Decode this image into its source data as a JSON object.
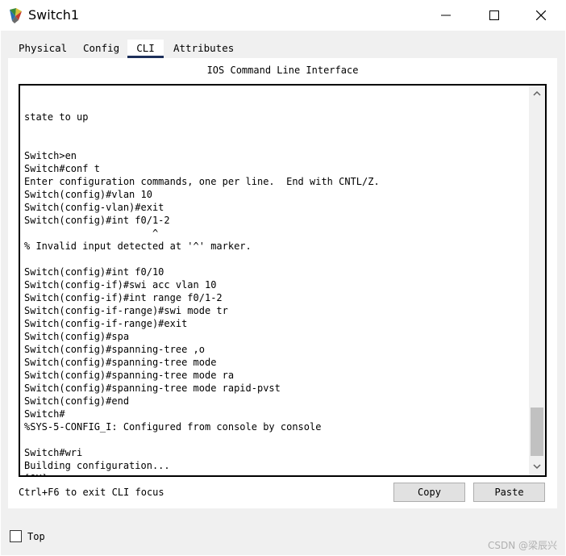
{
  "window": {
    "title": "Switch1",
    "minimize_icon": "minimize-icon",
    "maximize_icon": "maximize-icon",
    "close_icon": "close-icon"
  },
  "tabs": [
    {
      "label": "Physical"
    },
    {
      "label": "Config"
    },
    {
      "label": "CLI",
      "active": true
    },
    {
      "label": "Attributes"
    }
  ],
  "panel": {
    "header": "IOS Command Line Interface"
  },
  "console": {
    "lines": [
      "state to up",
      "",
      "",
      "Switch>en",
      "Switch#conf t",
      "Enter configuration commands, one per line.  End with CNTL/Z.",
      "Switch(config)#vlan 10",
      "Switch(config-vlan)#exit",
      "Switch(config)#int f0/1-2",
      "                      ^",
      "% Invalid input detected at '^' marker.",
      "",
      "Switch(config)#int f0/10",
      "Switch(config-if)#swi acc vlan 10",
      "Switch(config-if)#int range f0/1-2",
      "Switch(config-if-range)#swi mode tr",
      "Switch(config-if-range)#exit",
      "Switch(config)#spa",
      "Switch(config)#spanning-tree ,o",
      "Switch(config)#spanning-tree mode",
      "Switch(config)#spanning-tree mode ra",
      "Switch(config)#spanning-tree mode rapid-pvst",
      "Switch(config)#end",
      "Switch#",
      "%SYS-5-CONFIG_I: Configured from console by console",
      "",
      "Switch#wri",
      "Building configuration...",
      "[OK]"
    ],
    "prompt": "Switch#"
  },
  "footer": {
    "hint": "Ctrl+F6 to exit CLI focus",
    "copy_label": "Copy",
    "paste_label": "Paste"
  },
  "bottom": {
    "top_label": "Top",
    "top_checked": false,
    "watermark": "CSDN @梁辰兴"
  },
  "colors": {
    "window_bg": "#ffffff",
    "body_bg": "#f0f0f0",
    "tab_underline": "#1c2f5a",
    "button_bg": "#e1e1e1",
    "button_border": "#adadad",
    "scroll_thumb": "#c1c1c1"
  }
}
